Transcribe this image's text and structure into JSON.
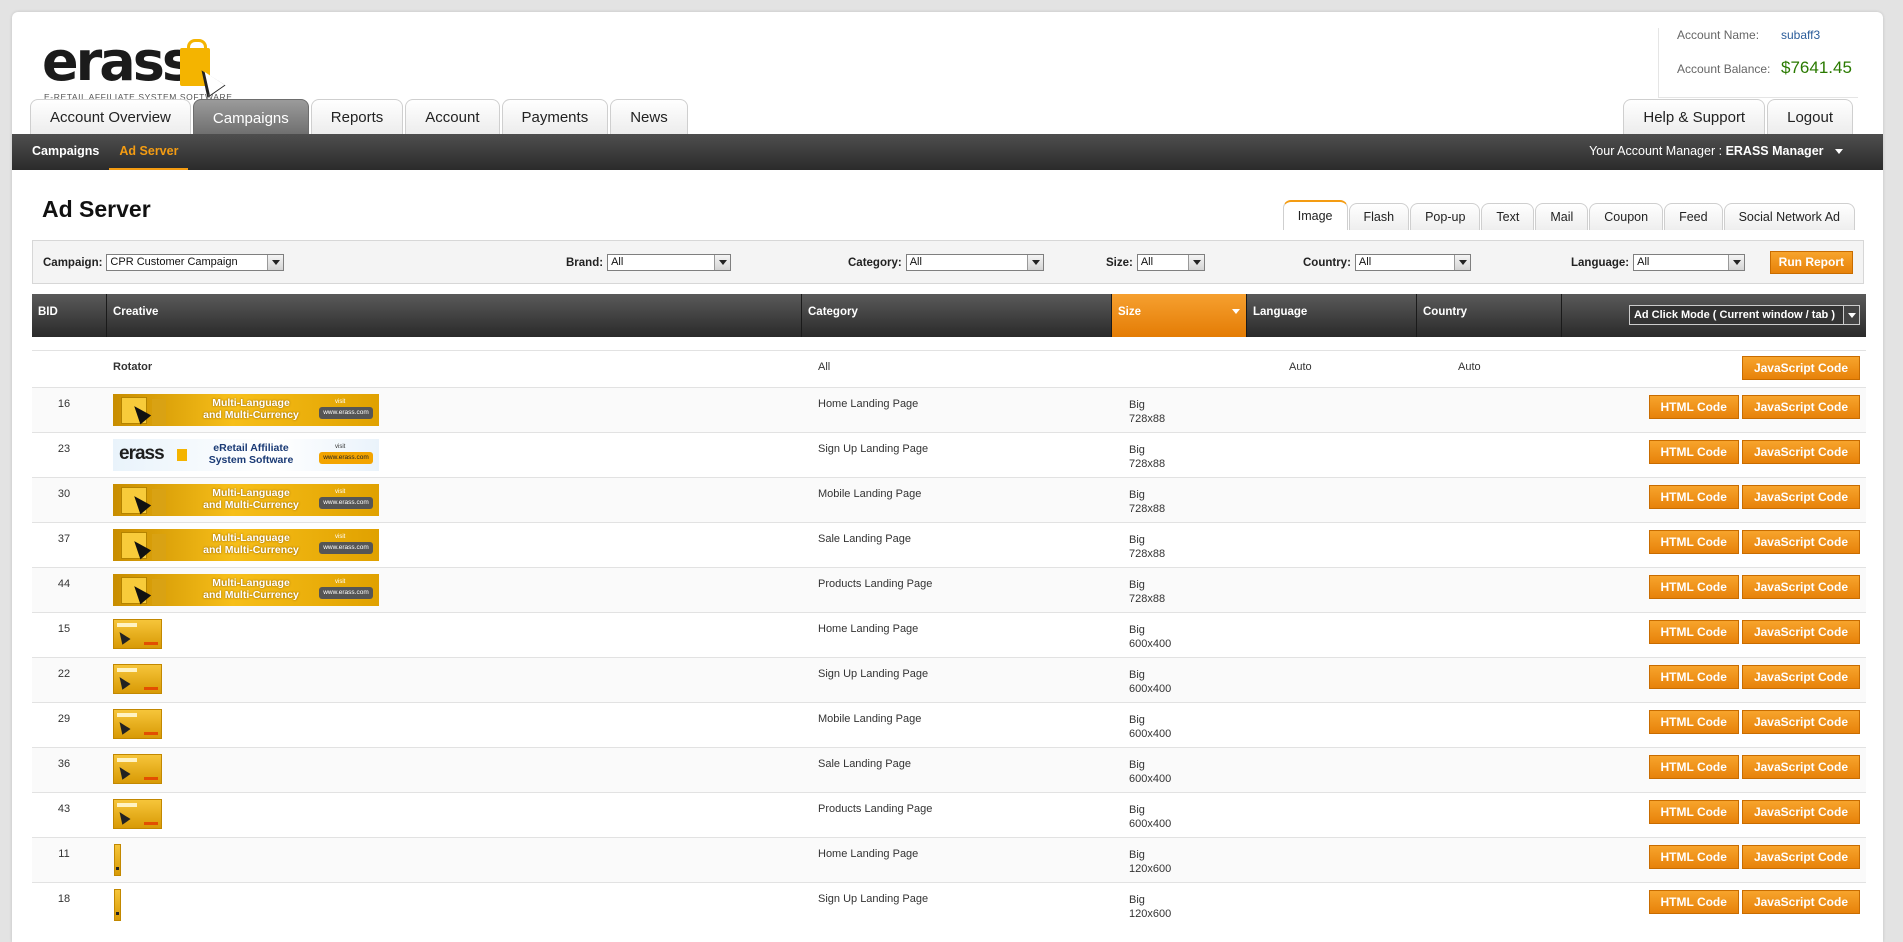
{
  "logo": {
    "word": "erass",
    "tagline": "E-RETAIL AFFILIATE SYSTEM SOFTWARE"
  },
  "account": {
    "name_label": "Account Name:",
    "name": "subaff3",
    "balance_label": "Account Balance:",
    "balance": "$7641.45"
  },
  "main_tabs": [
    "Account Overview",
    "Campaigns",
    "Reports",
    "Account",
    "Payments",
    "News"
  ],
  "right_tabs": [
    "Help & Support",
    "Logout"
  ],
  "subnav": [
    "Campaigns",
    "Ad Server"
  ],
  "manager": {
    "label": "Your Account Manager :",
    "name": "ERASS Manager"
  },
  "page_title": "Ad Server",
  "type_tabs": [
    "Image",
    "Flash",
    "Pop-up",
    "Text",
    "Mail",
    "Coupon",
    "Feed",
    "Social Network Ad"
  ],
  "filters": {
    "campaign": {
      "label": "Campaign:",
      "value": "CPR Customer Campaign"
    },
    "brand": {
      "label": "Brand:",
      "value": "All"
    },
    "category": {
      "label": "Category:",
      "value": "All"
    },
    "size": {
      "label": "Size:",
      "value": "All"
    },
    "country": {
      "label": "Country:",
      "value": "All"
    },
    "language": {
      "label": "Language:",
      "value": "All"
    },
    "run_label": "Run Report"
  },
  "columns": {
    "bid": "BID",
    "creative": "Creative",
    "category": "Category",
    "size": "Size",
    "language": "Language",
    "country": "Country",
    "click_mode": "Ad Click Mode ( Current window / tab )"
  },
  "buttons": {
    "html": "HTML Code",
    "js": "JavaScript Code"
  },
  "rotator": {
    "creative": "Rotator",
    "category": "All",
    "language": "Auto",
    "country": "Auto"
  },
  "banner_text": {
    "multi_line1": "Multi-Language",
    "multi_line2": "and Multi-Currency",
    "eretail_line1": "eRetail Affiliate",
    "eretail_line2": "System Software",
    "visit": "visit",
    "url": "www.erass.com",
    "erass": "erass"
  },
  "rows": [
    {
      "bid": "16",
      "creative": "multi",
      "category": "Home Landing Page",
      "size": "Big",
      "dims": "728x88"
    },
    {
      "bid": "23",
      "creative": "eretail",
      "category": "Sign Up Landing Page",
      "size": "Big",
      "dims": "728x88"
    },
    {
      "bid": "30",
      "creative": "multi",
      "category": "Mobile Landing Page",
      "size": "Big",
      "dims": "728x88"
    },
    {
      "bid": "37",
      "creative": "multi",
      "category": "Sale Landing Page",
      "size": "Big",
      "dims": "728x88"
    },
    {
      "bid": "44",
      "creative": "multi",
      "category": "Products Landing Page",
      "size": "Big",
      "dims": "728x88"
    },
    {
      "bid": "15",
      "creative": "thumb",
      "category": "Home Landing Page",
      "size": "Big",
      "dims": "600x400"
    },
    {
      "bid": "22",
      "creative": "thumb",
      "category": "Sign Up Landing Page",
      "size": "Big",
      "dims": "600x400"
    },
    {
      "bid": "29",
      "creative": "thumb",
      "category": "Mobile Landing Page",
      "size": "Big",
      "dims": "600x400"
    },
    {
      "bid": "36",
      "creative": "thumb",
      "category": "Sale Landing Page",
      "size": "Big",
      "dims": "600x400"
    },
    {
      "bid": "43",
      "creative": "thumb",
      "category": "Products Landing Page",
      "size": "Big",
      "dims": "600x400"
    },
    {
      "bid": "11",
      "creative": "sky",
      "category": "Home Landing Page",
      "size": "Big",
      "dims": "120x600"
    },
    {
      "bid": "18",
      "creative": "sky",
      "category": "Sign Up Landing Page",
      "size": "Big",
      "dims": "120x600"
    }
  ],
  "colors": {
    "accent": "#f49c12",
    "header_dark": "#2b2b2b",
    "balance": "#2a7a00",
    "link": "#2a5c9a"
  }
}
